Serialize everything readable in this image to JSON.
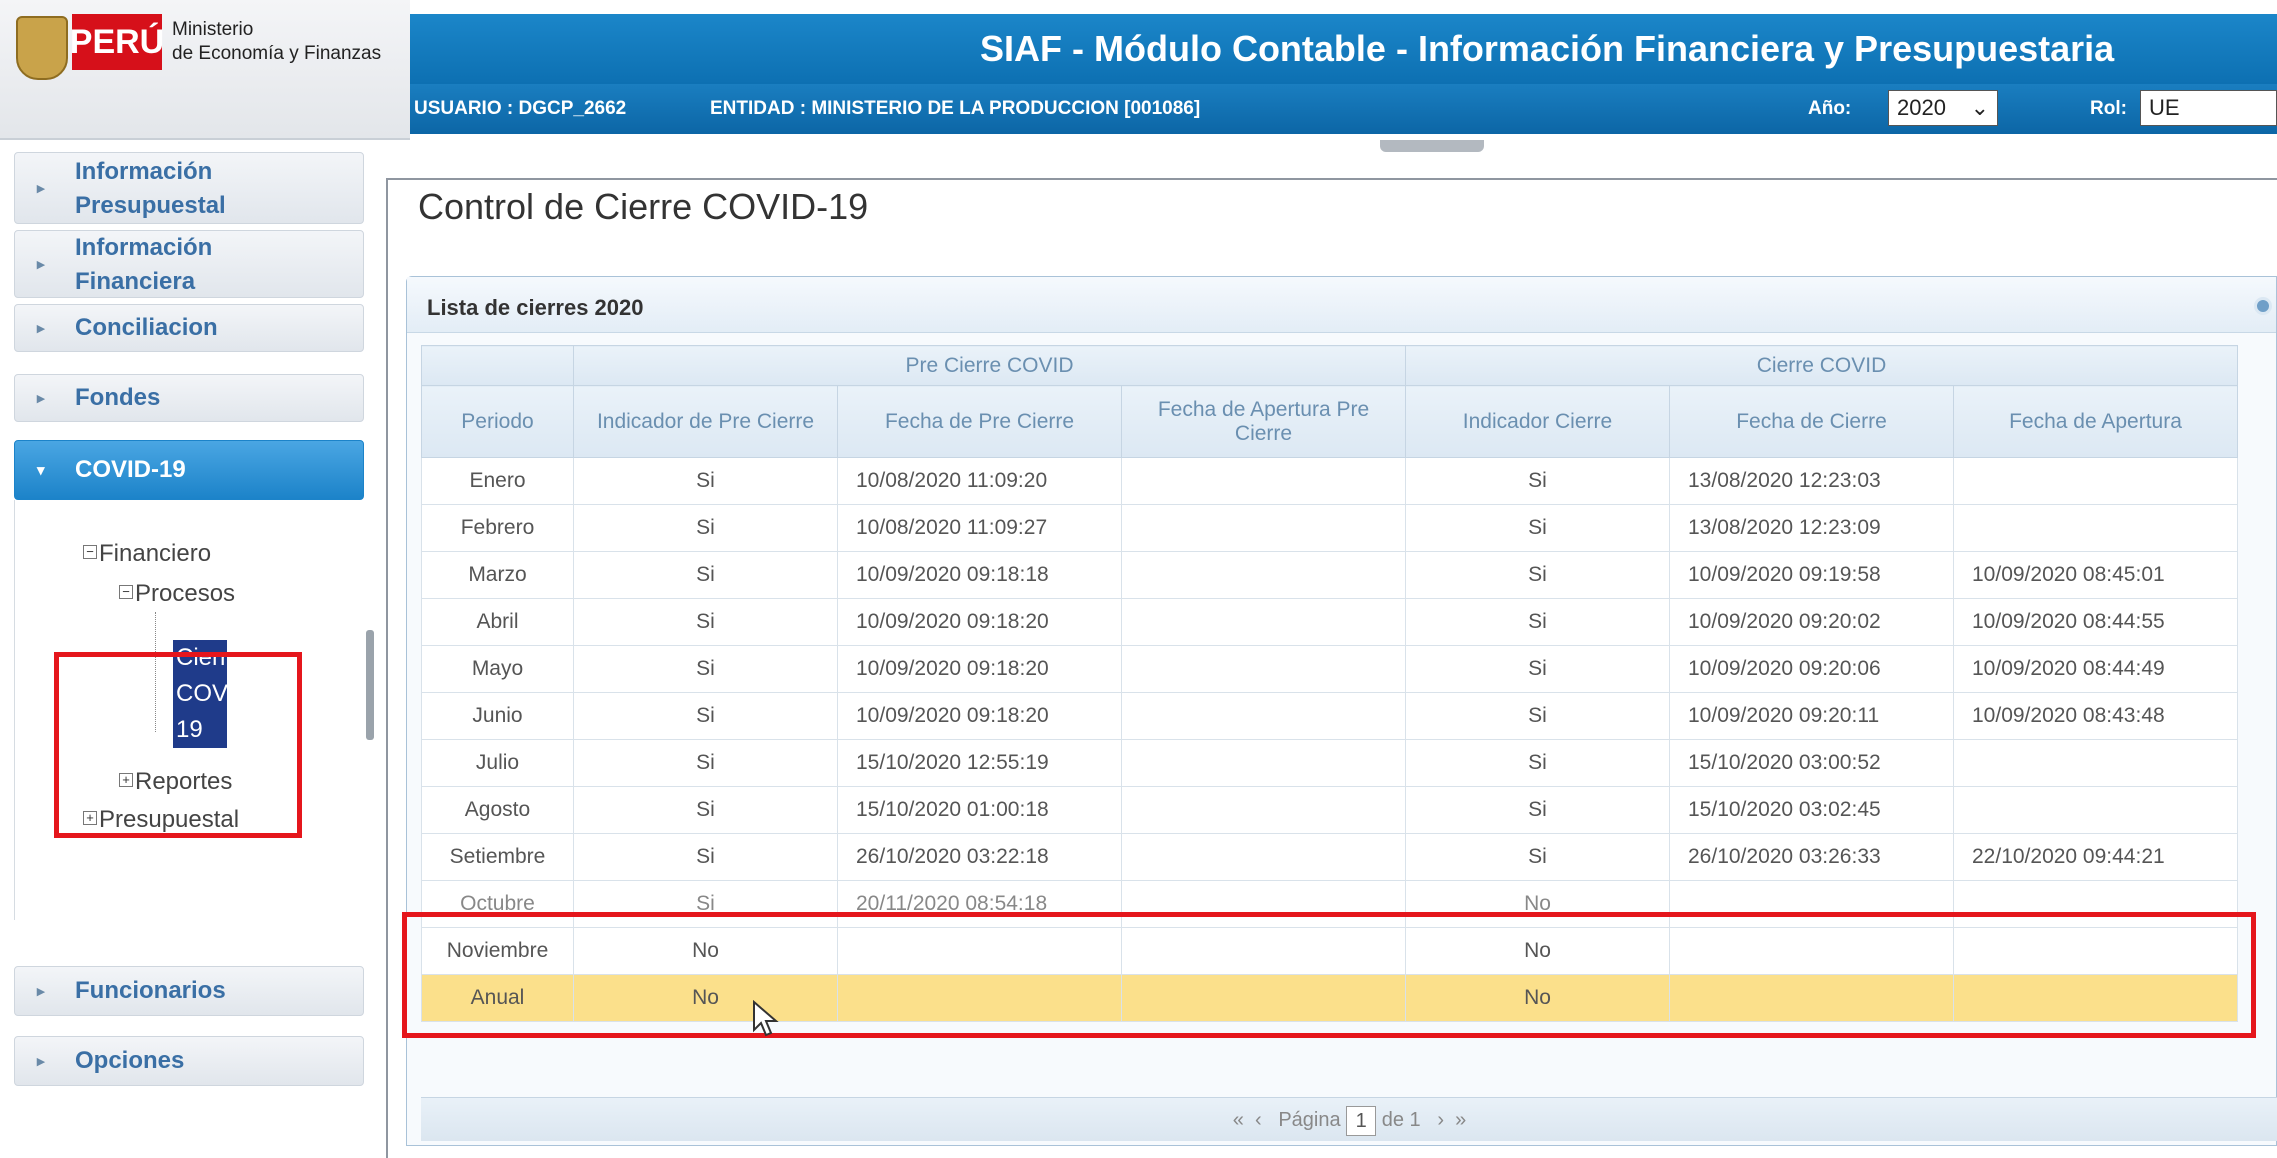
{
  "logo": {
    "country": "PERÚ",
    "line1": "Ministerio",
    "line2": "de Economía y Finanzas"
  },
  "header": {
    "title": "SIAF - Módulo Contable - Información Financiera y Presupuestaria",
    "usuario": "USUARIO : DGCP_2662",
    "entidad": "ENTIDAD : MINISTERIO DE LA PRODUCCION [001086]",
    "anio_label": "Año:",
    "anio_value": "2020",
    "rol_label": "Rol:",
    "rol_value": "UE"
  },
  "sidebar": {
    "items": [
      {
        "label": "Información Presupuestal"
      },
      {
        "label": "Información Financiera"
      },
      {
        "label": "Conciliacion"
      },
      {
        "label": "Fondes"
      },
      {
        "label": "COVID-19"
      },
      {
        "label": "Funcionarios"
      },
      {
        "label": "Opciones"
      }
    ],
    "tree": {
      "financiero": "Financiero",
      "procesos": "Procesos",
      "cierre_line1": "Cierre",
      "cierre_line2": "COVID-",
      "cierre_line3": "19",
      "reportes": "Reportes",
      "presupuestal": "Presupuestal"
    }
  },
  "main": {
    "legend": "Control de Cierre COVID-19",
    "panel_title": "Lista de cierres 2020",
    "group_pre": "Pre Cierre COVID",
    "group_cierre": "Cierre COVID",
    "columns": [
      "Periodo",
      "Indicador de Pre Cierre",
      "Fecha de Pre Cierre",
      "Fecha de Apertura Pre Cierre",
      "Indicador Cierre",
      "Fecha de Cierre",
      "Fecha de Apertura"
    ],
    "rows": [
      [
        "Enero",
        "Si",
        "10/08/2020 11:09:20",
        "",
        "Si",
        "13/08/2020 12:23:03",
        ""
      ],
      [
        "Febrero",
        "Si",
        "10/08/2020 11:09:27",
        "",
        "Si",
        "13/08/2020 12:23:09",
        ""
      ],
      [
        "Marzo",
        "Si",
        "10/09/2020 09:18:18",
        "",
        "Si",
        "10/09/2020 09:19:58",
        "10/09/2020 08:45:01"
      ],
      [
        "Abril",
        "Si",
        "10/09/2020 09:18:20",
        "",
        "Si",
        "10/09/2020 09:20:02",
        "10/09/2020 08:44:55"
      ],
      [
        "Mayo",
        "Si",
        "10/09/2020 09:18:20",
        "",
        "Si",
        "10/09/2020 09:20:06",
        "10/09/2020 08:44:49"
      ],
      [
        "Junio",
        "Si",
        "10/09/2020 09:18:20",
        "",
        "Si",
        "10/09/2020 09:20:11",
        "10/09/2020 08:43:48"
      ],
      [
        "Julio",
        "Si",
        "15/10/2020 12:55:19",
        "",
        "Si",
        "15/10/2020 03:00:52",
        ""
      ],
      [
        "Agosto",
        "Si",
        "15/10/2020 01:00:18",
        "",
        "Si",
        "15/10/2020 03:02:45",
        ""
      ],
      [
        "Setiembre",
        "Si",
        "26/10/2020 03:22:18",
        "",
        "Si",
        "26/10/2020 03:26:33",
        "22/10/2020 09:44:21"
      ],
      [
        "Octubre",
        "Si",
        "20/11/2020 08:54:18",
        "",
        "No",
        "",
        ""
      ],
      [
        "Noviembre",
        "No",
        "",
        "",
        "No",
        "",
        ""
      ],
      [
        "Anual",
        "No",
        "",
        "",
        "No",
        "",
        ""
      ]
    ],
    "pager": {
      "first": "«",
      "prev": "‹",
      "label": "Página",
      "page": "1",
      "of": "de 1",
      "next": "›",
      "last": "»"
    }
  }
}
